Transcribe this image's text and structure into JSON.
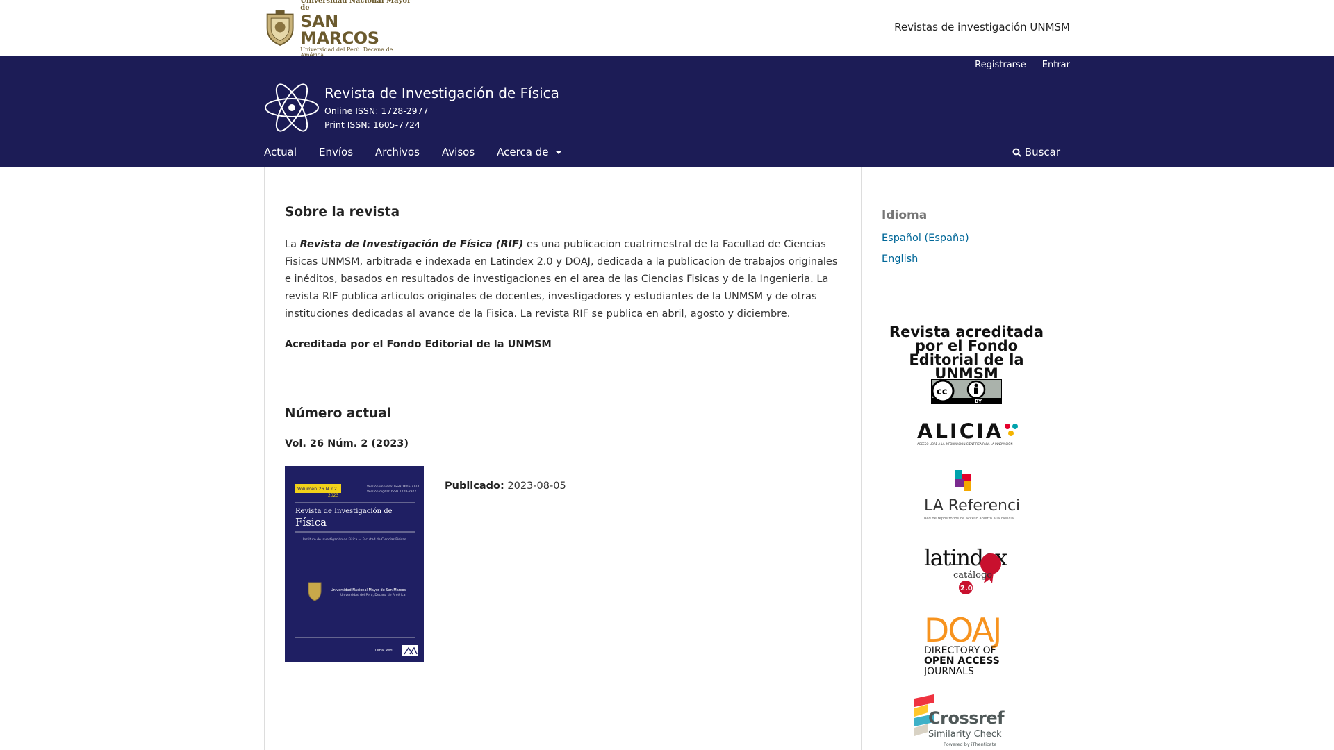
{
  "university": {
    "line1": "Universidad Nacional Mayor de",
    "line2": "SAN MARCOS",
    "line3": "Universidad del Perú. Decana de América",
    "link": "Revistas de investigación UNMSM"
  },
  "user_nav": {
    "register": "Registrarse",
    "login": "Entrar"
  },
  "journal": {
    "title": "Revista de Investigación de Física",
    "issn_online": "Online ISSN: 1728-2977",
    "issn_print": "Print ISSN: 1605-7724"
  },
  "nav": {
    "items": [
      "Actual",
      "Envíos",
      "Archivos",
      "Avisos",
      "Acerca de"
    ],
    "search": "Buscar"
  },
  "about": {
    "heading": "Sobre la revista",
    "text_pre": "La ",
    "text_strong": "Revista de Investigación de Física (RIF)",
    "text_post": " es una publicacion cuatrimestral de la Facultad de Ciencias Fisicas UNMSM, arbitrada e indexada en Latindex 2.0 y DOAJ, dedicada a la publicacion de trabajos originales e inéditos, basados en resultados de investigaciones en el area de las Ciencias Fisicas y de la Ingenieria. La revista RIF publica articulos originales de docentes, investigadores y estudiantes de la UNMSM y de otras instituciones dedicadas al avance de la Fisica. La revista RIF se publica en abril, agosto y diciembre.",
    "accredited": "Acreditada por el Fondo Editorial de la UNMSM"
  },
  "current_issue": {
    "heading": "Número actual",
    "identification": "Vol. 26 Núm. 2 (2023)",
    "published_label": "Publicado:",
    "published_date": "2023-08-05",
    "cover": {
      "volume": "Volumen 26 N.º 2",
      "year": "2023",
      "issn_lines": [
        "Versión impresa: ISSN 1605-7724",
        "Versión digital: ISSN 1728-2977"
      ],
      "title_top": "Revista de Investigación de",
      "title_main": "Física",
      "institute": "Instituto de Investigación de Física — Facultad de Ciencias Físicas",
      "uni_line1": "Universidad Nacional Mayor de San Marcos",
      "uni_line2": "Universidad del Perú, Decana de América",
      "place": "Lima, Perú"
    }
  },
  "sidebar": {
    "language_title": "Idioma",
    "languages": [
      "Español (España)",
      "English"
    ],
    "accredited_block": "Revista acreditada por el Fondo Editorial de la UNMSM",
    "cc_label": "BY",
    "alicia": {
      "name": "ALICIA",
      "tagline": "ACCESO LIBRE A LA INFORMACIÓN CIENTÍFICA PARA LA INNOVACIÓN"
    },
    "la_referencia": {
      "name": "LA Referencia",
      "tagline": "Red de repositorios de acceso abierto a la ciencia"
    },
    "latindex": {
      "name": "latindex",
      "sub": "catálogo",
      "version": "2.0"
    },
    "doaj": {
      "name": "DOAJ",
      "line1": "DIRECTORY OF",
      "line2": "OPEN ACCESS",
      "line3": "JOURNALS"
    },
    "crossref": {
      "name": "Crossref",
      "line1": "Similarity Check",
      "line2": "Powered by iThenticate"
    }
  },
  "colors": {
    "header_bg": "#1c1c56",
    "link": "#006798",
    "doaj_orange": "#f7931e",
    "crossref_red": "#ef3340",
    "latindex_red": "#c8102e"
  }
}
